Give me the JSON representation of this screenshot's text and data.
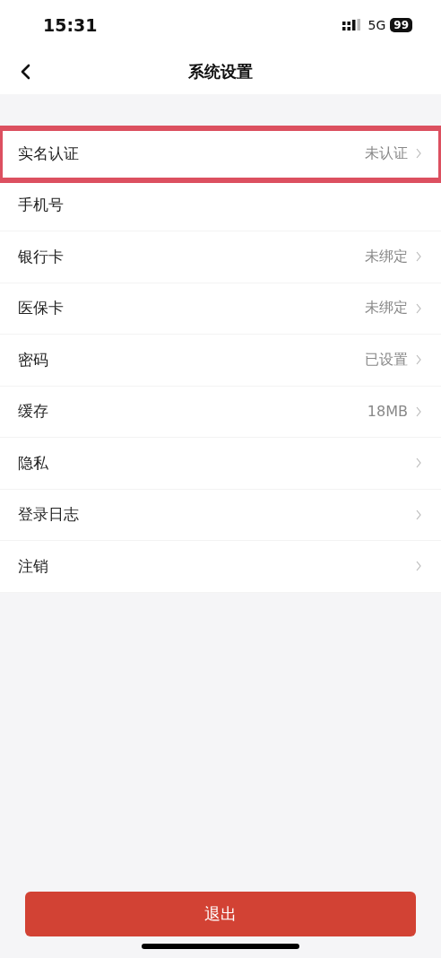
{
  "status_bar": {
    "time": "15:31",
    "network": "5G",
    "battery": "99"
  },
  "nav": {
    "title": "系统设置"
  },
  "items": [
    {
      "label": "实名认证",
      "value": "未认证",
      "chevron": true,
      "highlighted": true
    },
    {
      "label": "手机号",
      "chevron": false,
      "highlighted": false
    },
    {
      "label": "银行卡",
      "value": "未绑定",
      "chevron": true,
      "highlighted": false
    },
    {
      "label": "医保卡",
      "value": "未绑定",
      "chevron": true,
      "highlighted": false
    },
    {
      "label": "密码",
      "value": "已设置",
      "chevron": true,
      "highlighted": false
    },
    {
      "label": "缓存",
      "value": "18MB",
      "chevron": true,
      "highlighted": false
    },
    {
      "label": "隐私",
      "chevron": true,
      "highlighted": false
    },
    {
      "label": "登录日志",
      "chevron": true,
      "highlighted": false
    },
    {
      "label": "注销",
      "chevron": true,
      "highlighted": false
    }
  ],
  "logout_button": "退出"
}
